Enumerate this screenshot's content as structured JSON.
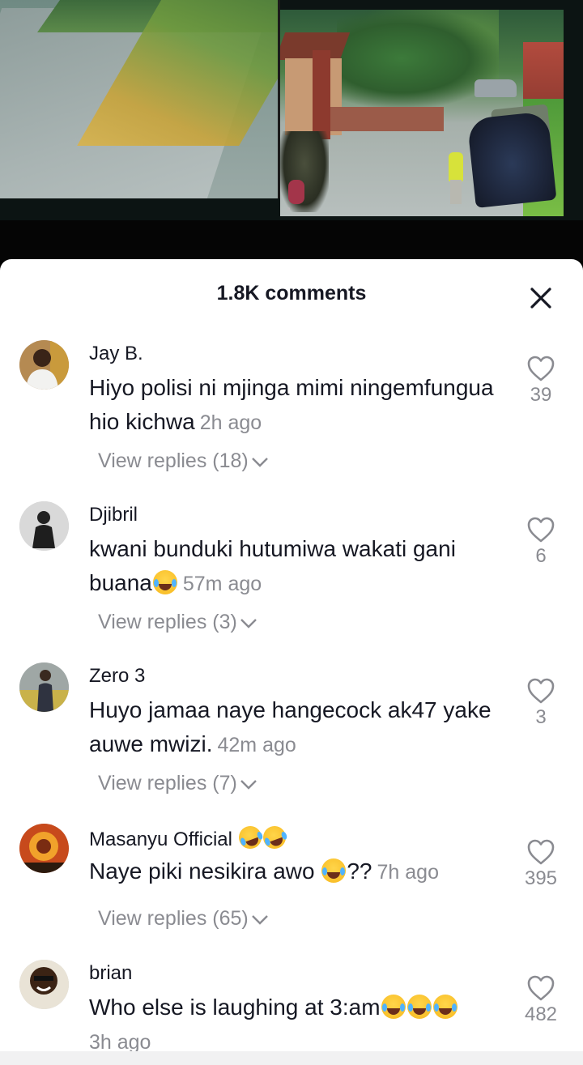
{
  "sheet": {
    "title": "1.8K comments"
  },
  "comments": [
    {
      "user": "Jay B.",
      "text": "Hiyo polisi ni mjinga mimi ningemfungua hio kichwa",
      "time": "2h ago",
      "replies": "View replies (18)",
      "likes": "39",
      "avatar_icon": "avatar-jay-b"
    },
    {
      "user": "Djibril",
      "text": "kwani bunduki hutumiwa wakati gani buana",
      "time": "57m ago",
      "replies": "View replies (3)",
      "likes": "6",
      "avatar_icon": "avatar-djibril"
    },
    {
      "user": "Zero 3",
      "text": "Huyo jamaa naye hangecock ak47 yake auwe mwizi.",
      "time": "42m ago",
      "replies": "View replies (7)",
      "likes": "3",
      "avatar_icon": "avatar-zero-3"
    },
    {
      "user": "Masanyu Official",
      "text": "Naye piki nesikira awo",
      "text_suffix": "??",
      "time": "7h ago",
      "replies": "View replies (65)",
      "likes": "395",
      "avatar_icon": "avatar-masanyu"
    },
    {
      "user": "brian",
      "text": "Who else is laughing at 3:am",
      "time": "3h ago",
      "likes": "482",
      "avatar_icon": "avatar-brian"
    }
  ],
  "icons": {
    "close": "close-icon",
    "like": "heart-outline-icon",
    "expand": "chevron-down-icon",
    "emoji": "face-with-tears-of-joy-emoji"
  },
  "colors": {
    "text_primary": "#161823",
    "text_secondary": "#8a8b91",
    "sheet_bg": "#ffffff"
  }
}
